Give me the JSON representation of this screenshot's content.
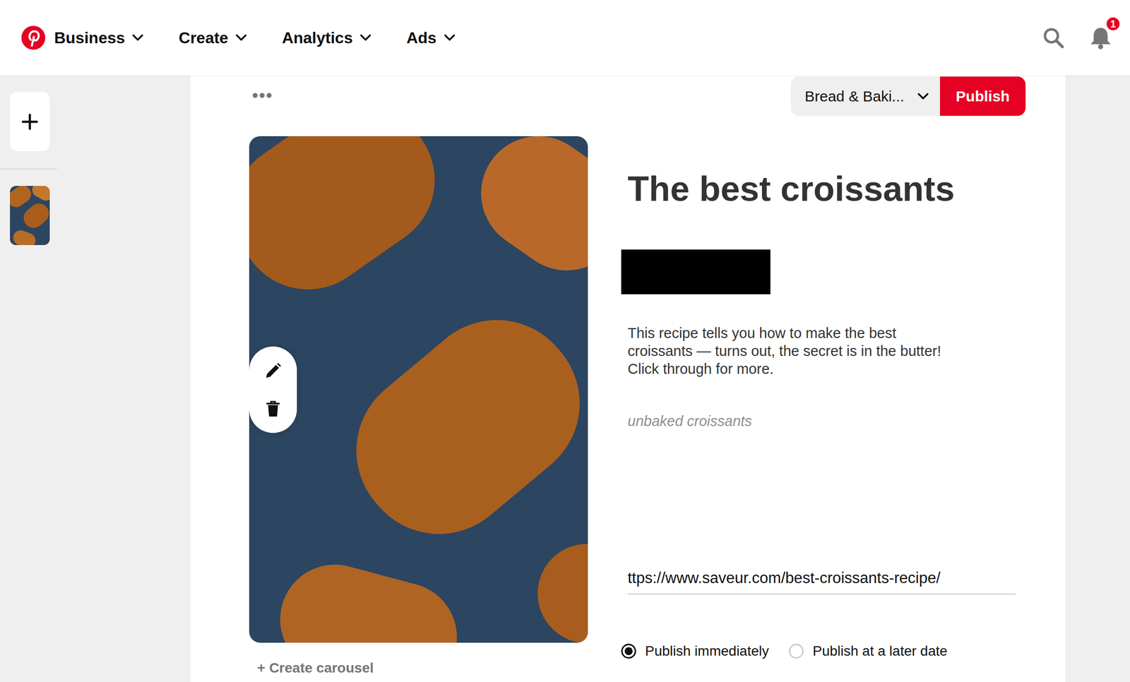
{
  "header": {
    "nav": [
      {
        "label": "Business"
      },
      {
        "label": "Create"
      },
      {
        "label": "Analytics"
      },
      {
        "label": "Ads"
      }
    ],
    "notifications": "1"
  },
  "pin": {
    "board": "Bread & Baki...",
    "publish": "Publish",
    "title": "The best croissants",
    "description_lines": [
      "This recipe tells you how to make the best",
      "croissants — turns out, the secret is in the butter!",
      "Click through for more."
    ],
    "alt_text": "unbaked croissants",
    "link": "ttps://www.saveur.com/best-croissants-recipe/",
    "create_carousel": "+ Create carousel",
    "publish_options": [
      {
        "label": "Publish immediately",
        "selected": true
      },
      {
        "label": "Publish at a later date",
        "selected": false
      }
    ]
  }
}
